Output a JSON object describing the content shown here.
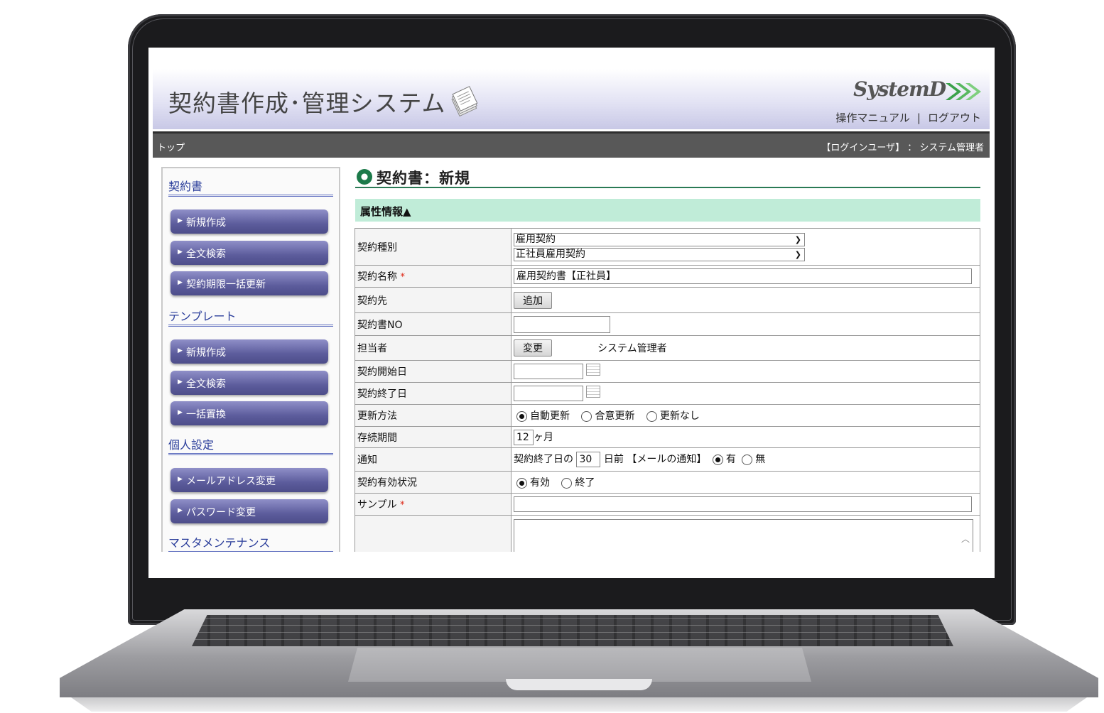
{
  "app": {
    "title": "契約書作成･管理システム",
    "logo_text": "SystemD",
    "manual_link": "操作マニュアル",
    "separator": "|",
    "logout_link": "ログアウト",
    "breadcrumb": "トップ",
    "login_user": "【ログインユーザ】 ： システム管理者"
  },
  "sidebar": {
    "sections": [
      {
        "title": "契約書",
        "items": [
          "新規作成",
          "全文検索",
          "契約期限一括更新"
        ]
      },
      {
        "title": "テンプレート",
        "items": [
          "新規作成",
          "全文検索",
          "一括置換"
        ]
      },
      {
        "title": "個人設定",
        "items": [
          "メールアドレス変更",
          "パスワード変更"
        ]
      },
      {
        "title": "マスタメンテナンス",
        "items": []
      }
    ]
  },
  "page": {
    "title": "契約書：新規",
    "section_title": "属性情報▲"
  },
  "form": {
    "contract_type_label": "契約種別",
    "contract_type_value": "雇用契約",
    "contract_subtype_value": "正社員雇用契約",
    "contract_name_label": "契約名称",
    "contract_name_value": "雇用契約書【正社員】",
    "required_mark": "*",
    "counterparty_label": "契約先",
    "add_button": "追加",
    "contract_no_label": "契約書NO",
    "contract_no_value": "",
    "owner_label": "担当者",
    "change_button": "変更",
    "owner_value": "システム管理者",
    "start_date_label": "契約開始日",
    "end_date_label": "契約終了日",
    "renewal_label": "更新方法",
    "renewal_options": [
      "自動更新",
      "合意更新",
      "更新なし"
    ],
    "renewal_selected": "自動更新",
    "period_label": "存続期間",
    "period_value": "12",
    "period_unit": "ヶ月",
    "notify_label": "通知",
    "notify_prefix": "契約終了日の",
    "notify_days": "30",
    "notify_suffix": "日前 【メールの通知】",
    "notify_yes": "有",
    "notify_no": "無",
    "notify_selected": "有",
    "status_label": "契約有効状況",
    "status_options": [
      "有効",
      "終了"
    ],
    "status_selected": "有効",
    "sample_label": "サンプル",
    "sample_value": ""
  },
  "colors": {
    "menu_button": "#5c5c9c",
    "section_bar": "#c0ecd8",
    "nav_bar": "#585858",
    "required": "#d21111"
  }
}
